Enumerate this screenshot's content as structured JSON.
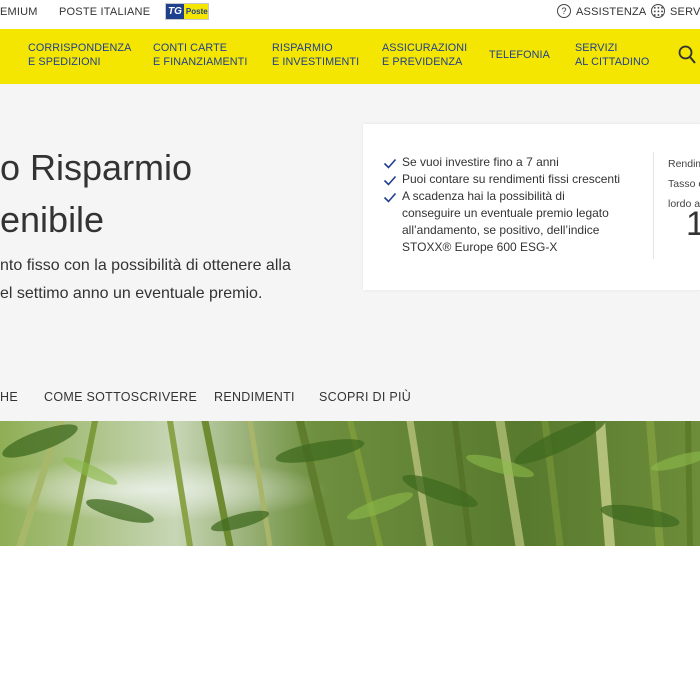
{
  "topbar": {
    "premium": "EMIUM",
    "poste_italiane": "POSTE ITALIANE",
    "tg_logo_tg": "TG",
    "tg_logo_word": "Poste",
    "help_symbol": "?",
    "assistenza": "ASSISTENZA",
    "servizi": "SERVI"
  },
  "nav": {
    "items": [
      {
        "line1": "CORRISPONDENZA",
        "line2": "E SPEDIZIONI"
      },
      {
        "line1": "CONTI CARTE",
        "line2": "E FINANZIAMENTI"
      },
      {
        "line1": "RISPARMIO",
        "line2": "E INVESTIMENTI"
      },
      {
        "line1": "ASSICURAZIONI",
        "line2": "E PREVIDENZA"
      },
      {
        "line1": "TELEFONIA",
        "line2": ""
      },
      {
        "line1": "SERVIZI",
        "line2": "AL CITTADINO"
      }
    ]
  },
  "hero": {
    "title_line1": "o Risparmio",
    "title_line2": "enibile",
    "lead_line1": "nto fisso con la possibilità di ottenere alla",
    "lead_line2": "el settimo anno un eventuale premio.",
    "card": {
      "bullets": [
        {
          "lines": [
            "Se vuoi investire fino a 7 anni"
          ]
        },
        {
          "lines": [
            "Puoi contare su rendimenti fissi crescenti"
          ]
        },
        {
          "lines": [
            "A scadenza hai la possibilità di",
            "conseguire un eventuale premio legato",
            "all’andamento, se positivo, dell’indice",
            "STOXX® Europe 600 ESG-X"
          ]
        }
      ],
      "side_lines": [
        "Rendim",
        "Tasso e",
        "lordo a"
      ],
      "big_number": "1"
    }
  },
  "tabs": [
    "HE",
    "COME SOTTOSCRIVERE",
    "RENDIMENTI",
    "SCOPRI DI PIÙ"
  ],
  "colors": {
    "brand_yellow": "#f4e600",
    "brand_blue": "#1f3f8f",
    "check_blue": "#1f3f8f",
    "hero_background": "#f5f5f5"
  },
  "icons": {
    "help": "question-circle-icon",
    "services": "grid-circle-icon",
    "search": "search-icon",
    "check": "check-icon"
  }
}
